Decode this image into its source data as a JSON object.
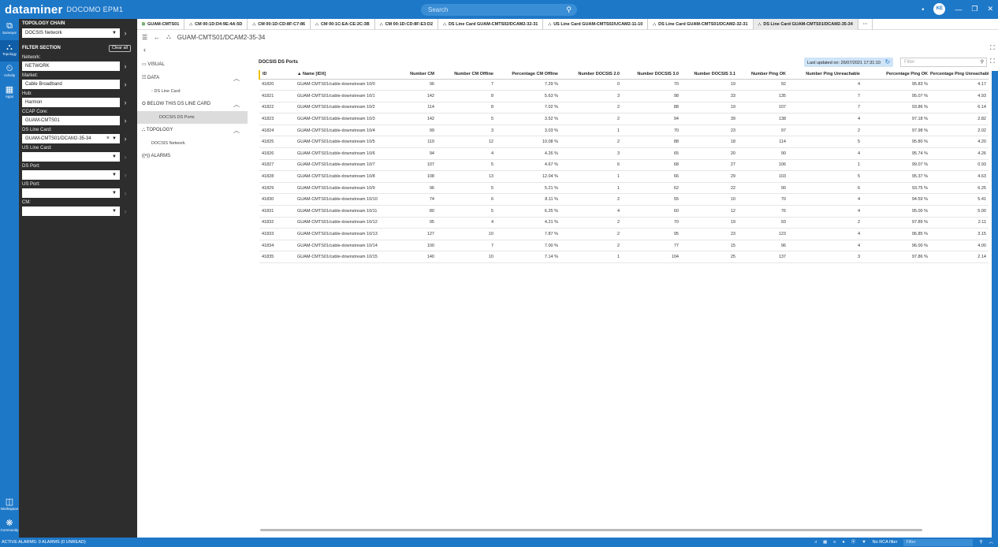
{
  "app": {
    "brand": "dataminer",
    "system": "DOCOMO EPM1",
    "search_placeholder": "Search",
    "user_initials": "KE"
  },
  "rail": [
    {
      "icon": "surveyor-icon",
      "glyph": "⧉",
      "label": "Surveyor"
    },
    {
      "icon": "topology-icon",
      "glyph": "⛬",
      "label": "Topology"
    },
    {
      "icon": "activity-icon",
      "glyph": "⏲",
      "label": "Activity"
    },
    {
      "icon": "apps-icon",
      "glyph": "▦",
      "label": "Apps"
    }
  ],
  "rail_bottom": [
    {
      "icon": "workspace-icon",
      "glyph": "◫",
      "label": "Workspace"
    },
    {
      "icon": "community-icon",
      "glyph": "❋",
      "label": "Community"
    }
  ],
  "panel": {
    "chain_title": "TOPOLOGY CHAIN",
    "chain_value": "DOCSIS Network",
    "filter_title": "FILTER SECTION",
    "clear_all": "Clear all",
    "filters": [
      {
        "label": "Network:",
        "value": "NETWORK",
        "kind": "text"
      },
      {
        "label": "Market:",
        "value": "Cable Broadband",
        "kind": "text"
      },
      {
        "label": "Hub:",
        "value": "Harmon",
        "kind": "text"
      },
      {
        "label": "CCAP Core:",
        "value": "GUAM-CMTS01",
        "kind": "text"
      },
      {
        "label": "DS Line Card:",
        "value": "GUAM-CMTS01/DCAM2-35-34",
        "kind": "select-clear"
      },
      {
        "label": "US Line Card:",
        "value": "",
        "kind": "select"
      },
      {
        "label": "DS Port:",
        "value": "",
        "kind": "select"
      },
      {
        "label": "US Port:",
        "value": "",
        "kind": "select"
      },
      {
        "label": "CM:",
        "value": "",
        "kind": "select"
      }
    ]
  },
  "tabs": [
    {
      "label": "GUAM-CMTS01",
      "active": false,
      "first": true
    },
    {
      "label": "CM 00:1D:D4:9E:4A:5D",
      "active": false
    },
    {
      "label": "CM 00:1D:CD:8F:C7:86",
      "active": false
    },
    {
      "label": "CM 00:1C:EA:CE:2C:3B",
      "active": false
    },
    {
      "label": "CM 00:1D:CD:8F:E3:D2",
      "active": false
    },
    {
      "label": "DS Line Card GUAM-CMTS02/DCAM2-32-31",
      "active": false
    },
    {
      "label": "US Line Card GUAM-CMTS02/UCAM2-11-10",
      "active": false
    },
    {
      "label": "DS Line Card GUAM-CMTS01/DCAM2-32-31",
      "active": false
    },
    {
      "label": "DS Line Card GUAM-CMTS01/DCAM2-35-34",
      "active": true
    }
  ],
  "breadcrumb": "GUAM-CMTS01/DCAM2-35-34",
  "nav": {
    "visual": "VISUAL",
    "data": "DATA",
    "data_child": "DS Line Card",
    "below": "BELOW THIS DS LINE CARD",
    "below_child": "DOCSIS DS Ports",
    "topology": "TOPOLOGY",
    "topology_child": "DOCSIS Network",
    "alarms": "ALARMS"
  },
  "table": {
    "title": "DOCSIS DS Ports",
    "last_updated": "Last updated on: 26/07/2021 17:31:10",
    "filter_placeholder": "Filter",
    "columns": [
      "ID",
      "Name [IDX]",
      "Number CM",
      "Number CM Offline",
      "Percentage CM Offline",
      "Number DOCSIS 2.0",
      "Number DOCSIS 3.0",
      "Number DOCSIS 3.1",
      "Number Ping OK",
      "Number Ping Unreachable",
      "Percentage Ping OK",
      "Percentage Ping Unreachable"
    ],
    "rows": [
      [
        "41820",
        "GUAM-CMTS01/cable-downstream 10/0",
        "96",
        "7",
        "7.29 %",
        "0",
        "70",
        "19",
        "92",
        "4",
        "95.83 %",
        "4.17"
      ],
      [
        "41821",
        "GUAM-CMTS01/cable-downstream 10/1",
        "142",
        "8",
        "5.63 %",
        "3",
        "98",
        "33",
        "135",
        "7",
        "95.07 %",
        "4.93"
      ],
      [
        "41822",
        "GUAM-CMTS01/cable-downstream 10/2",
        "114",
        "8",
        "7.02 %",
        "2",
        "88",
        "19",
        "107",
        "7",
        "93.86 %",
        "6.14"
      ],
      [
        "41823",
        "GUAM-CMTS01/cable-downstream 10/3",
        "142",
        "5",
        "3.52 %",
        "2",
        "94",
        "39",
        "138",
        "4",
        "97.18 %",
        "2.82"
      ],
      [
        "41824",
        "GUAM-CMTS01/cable-downstream 10/4",
        "99",
        "3",
        "3.03 %",
        "1",
        "70",
        "23",
        "97",
        "2",
        "97.98 %",
        "2.02"
      ],
      [
        "41825",
        "GUAM-CMTS01/cable-downstream 10/5",
        "119",
        "12",
        "10.08 %",
        "2",
        "88",
        "18",
        "114",
        "5",
        "95.80 %",
        "4.20"
      ],
      [
        "41826",
        "GUAM-CMTS01/cable-downstream 10/6",
        "94",
        "4",
        "4.26 %",
        "3",
        "65",
        "20",
        "90",
        "4",
        "95.74 %",
        "4.26"
      ],
      [
        "41827",
        "GUAM-CMTS01/cable-downstream 10/7",
        "107",
        "5",
        "4.67 %",
        "6",
        "68",
        "27",
        "106",
        "1",
        "99.07 %",
        "0.93"
      ],
      [
        "41828",
        "GUAM-CMTS01/cable-downstream 10/8",
        "108",
        "13",
        "12.04 %",
        "1",
        "66",
        "29",
        "103",
        "5",
        "95.37 %",
        "4.63"
      ],
      [
        "41829",
        "GUAM-CMTS01/cable-downstream 10/9",
        "96",
        "5",
        "5.21 %",
        "1",
        "62",
        "22",
        "90",
        "6",
        "93.75 %",
        "6.25"
      ],
      [
        "41830",
        "GUAM-CMTS01/cable-downstream 10/10",
        "74",
        "6",
        "8.11 %",
        "2",
        "55",
        "10",
        "70",
        "4",
        "94.59 %",
        "5.41"
      ],
      [
        "41831",
        "GUAM-CMTS01/cable-downstream 10/11",
        "80",
        "5",
        "6.25 %",
        "4",
        "60",
        "12",
        "76",
        "4",
        "95.00 %",
        "5.00"
      ],
      [
        "41832",
        "GUAM-CMTS01/cable-downstream 10/12",
        "95",
        "4",
        "4.21 %",
        "2",
        "70",
        "19",
        "93",
        "2",
        "97.89 %",
        "2.11"
      ],
      [
        "41833",
        "GUAM-CMTS01/cable-downstream 10/13",
        "127",
        "10",
        "7.87 %",
        "2",
        "95",
        "23",
        "123",
        "4",
        "96.85 %",
        "3.15"
      ],
      [
        "41834",
        "GUAM-CMTS01/cable-downstream 10/14",
        "100",
        "7",
        "7.00 %",
        "2",
        "77",
        "15",
        "96",
        "4",
        "96.00 %",
        "4.00"
      ],
      [
        "41835",
        "GUAM-CMTS01/cable-downstream 10/15",
        "140",
        "10",
        "7.14 %",
        "1",
        "104",
        "25",
        "137",
        "3",
        "97.86 %",
        "2.14"
      ]
    ]
  },
  "status": {
    "alarms": "ACTIVE ALARMS: 0 ALARMS (0 UNREAD)",
    "rca": "No RCA filter",
    "filter_placeholder": "Filter"
  }
}
